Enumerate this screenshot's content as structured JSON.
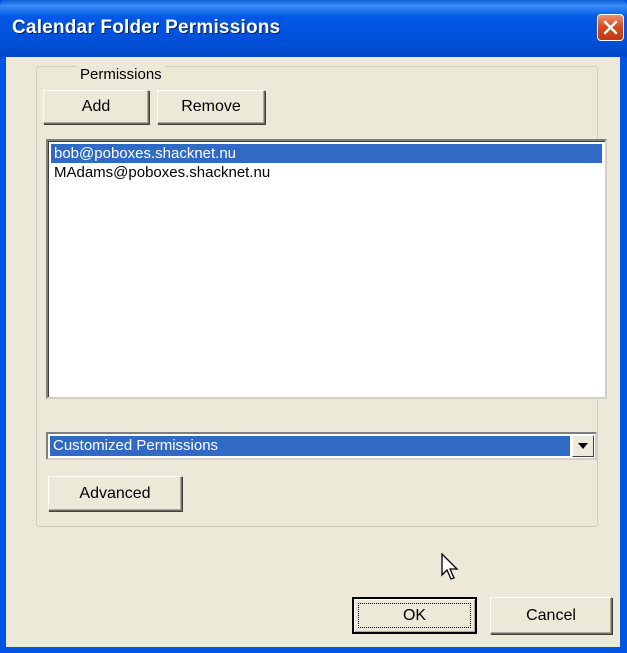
{
  "window": {
    "title": "Calendar Folder Permissions",
    "title_color": "#ffffff",
    "titlebar_color": "#0054e3"
  },
  "permissions": {
    "group_label": "Permissions",
    "add_label": "Add",
    "remove_label": "Remove",
    "users": [
      {
        "email": "bob@poboxes.shacknet.nu",
        "selected": true
      },
      {
        "email": "MAdams@poboxes.shacknet.nu",
        "selected": false
      }
    ],
    "level_select": {
      "value": "Customized Permissions"
    },
    "advanced_label": "Advanced"
  },
  "footer": {
    "ok_label": "OK",
    "cancel_label": "Cancel"
  },
  "colors": {
    "selection": "#316ac5",
    "dialog_bg": "#ece9d8",
    "close_button": "#d6481f"
  }
}
